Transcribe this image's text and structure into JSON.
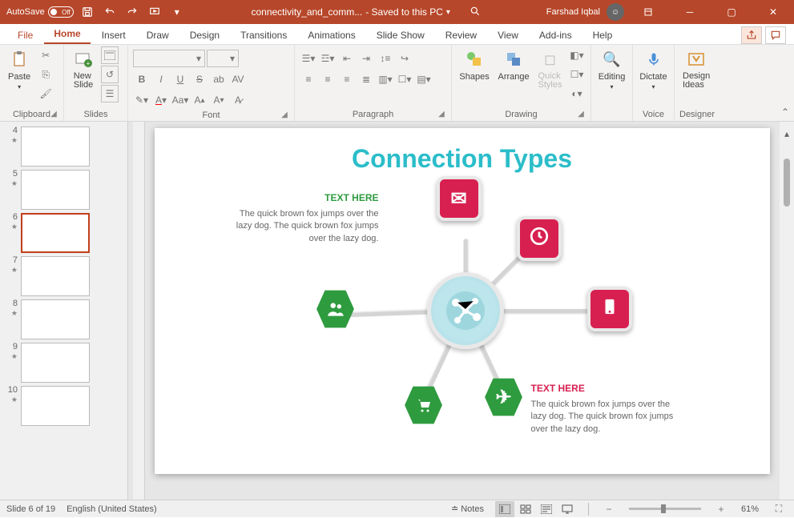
{
  "titlebar": {
    "autosave_label": "AutoSave",
    "autosave_state": "Off",
    "filename": "connectivity_and_comm...",
    "save_status": "- Saved to this PC",
    "user_name": "Farshad Iqbal"
  },
  "tabs": {
    "file": "File",
    "home": "Home",
    "insert": "Insert",
    "draw": "Draw",
    "design": "Design",
    "transitions": "Transitions",
    "animations": "Animations",
    "slideshow": "Slide Show",
    "review": "Review",
    "view": "View",
    "addins": "Add-ins",
    "help": "Help"
  },
  "ribbon": {
    "clipboard": {
      "label": "Clipboard",
      "paste": "Paste"
    },
    "slides": {
      "label": "Slides",
      "new_slide": "New\nSlide"
    },
    "font": {
      "label": "Font"
    },
    "paragraph": {
      "label": "Paragraph"
    },
    "drawing": {
      "label": "Drawing",
      "shapes": "Shapes",
      "arrange": "Arrange",
      "quick_styles": "Quick\nStyles"
    },
    "editing": {
      "label": "Editing",
      "button": "Editing"
    },
    "voice": {
      "label": "Voice",
      "dictate": "Dictate"
    },
    "designer": {
      "label": "Designer",
      "design_ideas": "Design\nIdeas"
    }
  },
  "thumbnails": [
    {
      "num": 4
    },
    {
      "num": 5
    },
    {
      "num": 6,
      "selected": true
    },
    {
      "num": 7
    },
    {
      "num": 8
    },
    {
      "num": 9
    },
    {
      "num": 10
    }
  ],
  "slide_content": {
    "title": "Connection Types",
    "left_heading": "TEXT HERE",
    "left_body": "The quick brown fox jumps over the lazy dog. The quick brown fox jumps over the lazy dog.",
    "right_heading": "TEXT HERE",
    "right_body": "The quick brown fox jumps over the lazy dog. The quick brown fox jumps over the lazy dog."
  },
  "status": {
    "slide_counter": "Slide 6 of 19",
    "language": "English (United States)",
    "notes": "Notes",
    "zoom": "61%"
  }
}
